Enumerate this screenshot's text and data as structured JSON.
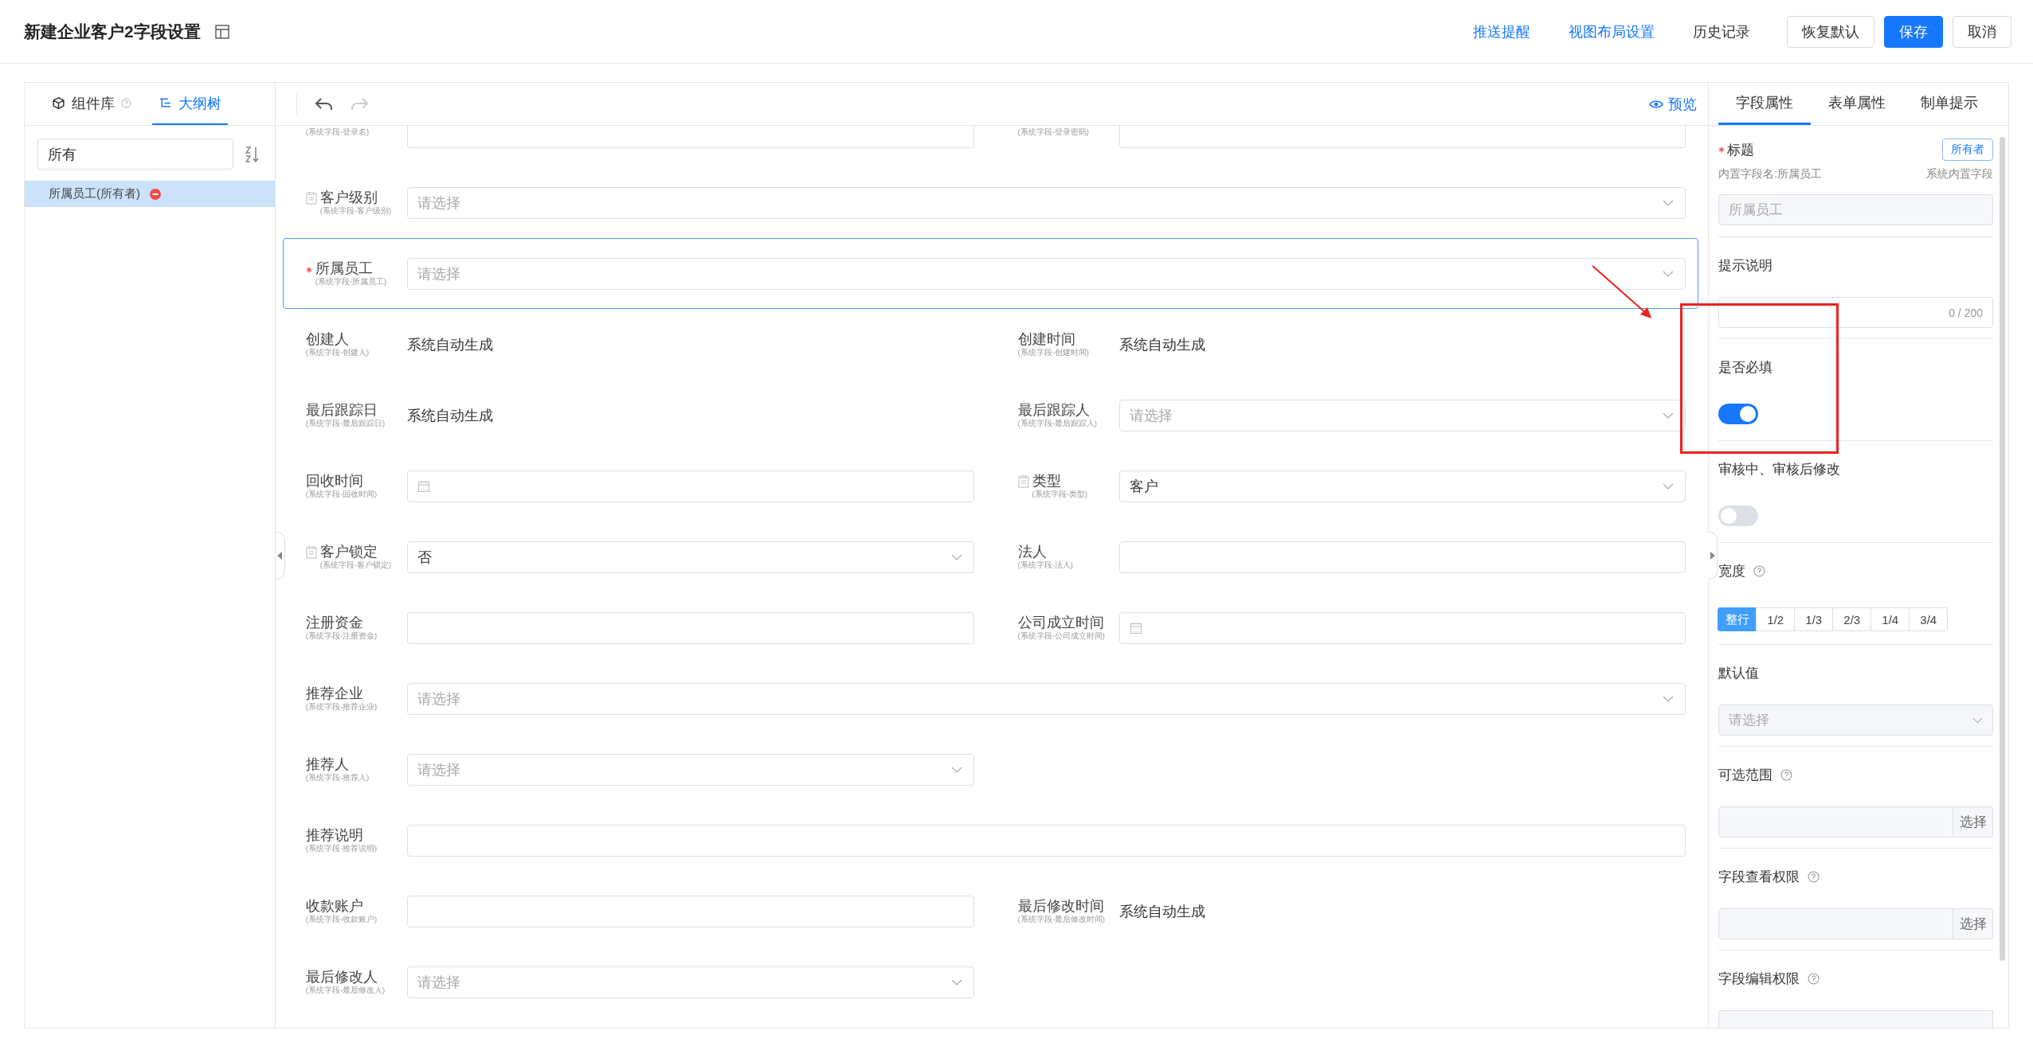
{
  "header": {
    "title": "新建企业客户2字段设置",
    "links": [
      "推送提醒",
      "视图布局设置"
    ],
    "history": "历史记录",
    "buttons": [
      {
        "label": "恢复默认",
        "kind": "default"
      },
      {
        "label": "保存",
        "kind": "primary"
      },
      {
        "label": "取消",
        "kind": "default"
      }
    ]
  },
  "left_panel": {
    "tabs": [
      {
        "label": "组件库",
        "help": true,
        "selected": false
      },
      {
        "label": "大纲树",
        "help": false,
        "selected": true
      }
    ],
    "filter": {
      "value": "所有"
    },
    "tree": [
      {
        "label": "所属员工(所有者)",
        "selected": true,
        "removable": true
      }
    ]
  },
  "toolbar": {
    "undo_enabled": true,
    "redo_enabled": false,
    "preview": "预览"
  },
  "form": {
    "rows": [
      {
        "full": false,
        "selected": false,
        "fields": [
          {
            "sub": "(系统字段-登录名)",
            "kind": "input",
            "required": false,
            "doc_icon": false
          },
          {
            "sub": "(系统字段-登录密码)",
            "kind": "input",
            "required": false,
            "doc_icon": false
          }
        ]
      },
      {
        "full": true,
        "selected": false,
        "fields": [
          {
            "label": "客户级别",
            "sub": "(系统字段-客户级别)",
            "kind": "select",
            "placeholder": "请选择",
            "required": false,
            "doc_icon": true
          }
        ]
      },
      {
        "full": true,
        "selected": true,
        "fields": [
          {
            "label": "所属员工",
            "sub": "(系统字段-所属员工)",
            "kind": "select",
            "placeholder": "请选择",
            "required": true,
            "doc_icon": false
          }
        ]
      },
      {
        "full": false,
        "selected": false,
        "fields": [
          {
            "label": "创建人",
            "sub": "(系统字段-创建人)",
            "kind": "auto",
            "value": "系统自动生成",
            "required": false,
            "doc_icon": false
          },
          {
            "label": "创建时间",
            "sub": "(系统字段-创建时间)",
            "kind": "auto",
            "value": "系统自动生成",
            "required": false,
            "doc_icon": false
          }
        ]
      },
      {
        "full": false,
        "selected": false,
        "fields": [
          {
            "label": "最后跟踪日",
            "sub": "(系统字段-最后跟踪日)",
            "kind": "auto",
            "value": "系统自动生成",
            "required": false,
            "doc_icon": false
          },
          {
            "label": "最后跟踪人",
            "sub": "(系统字段-最后跟踪人)",
            "kind": "select",
            "placeholder": "请选择",
            "required": false,
            "doc_icon": false
          }
        ]
      },
      {
        "full": false,
        "selected": false,
        "fields": [
          {
            "label": "回收时间",
            "sub": "(系统字段-回收时间)",
            "kind": "date",
            "required": false,
            "doc_icon": false
          },
          {
            "label": "类型",
            "sub": "(系统字段-类型)",
            "kind": "select",
            "value": "客户",
            "required": false,
            "doc_icon": true
          }
        ]
      },
      {
        "full": false,
        "selected": false,
        "fields": [
          {
            "label": "客户锁定",
            "sub": "(系统字段-客户锁定)",
            "kind": "select",
            "value": "否",
            "required": false,
            "doc_icon": true
          },
          {
            "label": "法人",
            "sub": "(系统字段-法人)",
            "kind": "input",
            "required": false,
            "doc_icon": false
          }
        ]
      },
      {
        "full": false,
        "selected": false,
        "fields": [
          {
            "label": "注册资金",
            "sub": "(系统字段-注册资金)",
            "kind": "input",
            "required": false,
            "doc_icon": false
          },
          {
            "label": "公司成立时间",
            "sub": "(系统字段-公司成立时间)",
            "kind": "date",
            "required": false,
            "doc_icon": false
          }
        ]
      },
      {
        "full": true,
        "selected": false,
        "fields": [
          {
            "label": "推荐企业",
            "sub": "(系统字段-推荐企业)",
            "kind": "select",
            "placeholder": "请选择",
            "required": false,
            "doc_icon": false
          }
        ]
      },
      {
        "full": false,
        "selected": false,
        "fields": [
          {
            "label": "推荐人",
            "sub": "(系统字段-推荐人)",
            "kind": "select",
            "placeholder": "请选择",
            "required": false,
            "doc_icon": false
          }
        ]
      },
      {
        "full": true,
        "selected": false,
        "fields": [
          {
            "label": "推荐说明",
            "sub": "(系统字段-推荐说明)",
            "kind": "input",
            "required": false,
            "doc_icon": false
          }
        ]
      },
      {
        "full": false,
        "selected": false,
        "fields": [
          {
            "label": "收款账户",
            "sub": "(系统字段-收款账户)",
            "kind": "input",
            "required": false,
            "doc_icon": false
          },
          {
            "label": "最后修改时间",
            "sub": "(系统字段-最后修改时间)",
            "kind": "auto",
            "value": "系统自动生成",
            "required": false,
            "doc_icon": false
          }
        ]
      },
      {
        "full": false,
        "selected": false,
        "fields": [
          {
            "label": "最后修改人",
            "sub": "(系统字段-最后修改人)",
            "kind": "select",
            "placeholder": "请选择",
            "required": false,
            "doc_icon": false
          }
        ]
      }
    ]
  },
  "properties": {
    "tabs": [
      {
        "label": "字段属性",
        "selected": true
      },
      {
        "label": "表单属性",
        "selected": false
      },
      {
        "label": "制单提示",
        "selected": false
      }
    ],
    "title": {
      "label": "标题",
      "required": true,
      "tag": "所有者",
      "builtin_name": "内置字段名:所属员工",
      "builtin_note": "系统内置字段",
      "value": "所属员工"
    },
    "hint": {
      "label": "提示说明",
      "counter": "0 / 200"
    },
    "required_switch": {
      "label": "是否必填",
      "on": true
    },
    "audit_switch": {
      "label": "审核中、审核后修改",
      "on": false
    },
    "width": {
      "label": "宽度",
      "options": [
        {
          "label": "整行",
          "selected": true
        },
        {
          "label": "1/2",
          "selected": false
        },
        {
          "label": "1/3",
          "selected": false
        },
        {
          "label": "2/3",
          "selected": false
        },
        {
          "label": "1/4",
          "selected": false
        },
        {
          "label": "3/4",
          "selected": false
        }
      ]
    },
    "default_value": {
      "label": "默认值",
      "placeholder": "请选择"
    },
    "pickers": [
      {
        "label": "可选范围",
        "button": "选择"
      },
      {
        "label": "字段查看权限",
        "button": "选择"
      },
      {
        "label": "字段编辑权限"
      }
    ]
  },
  "annotation": {
    "arrow": true,
    "box": true
  }
}
